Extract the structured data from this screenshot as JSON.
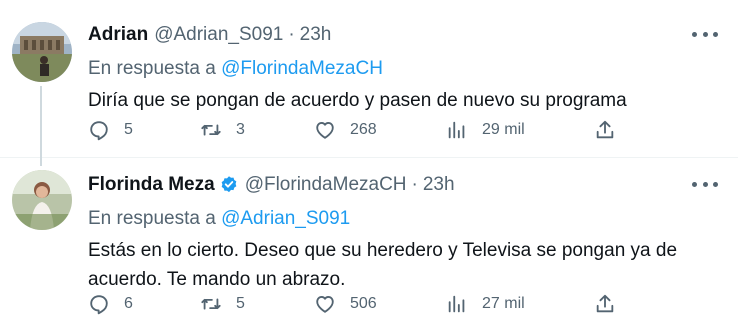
{
  "colors": {
    "link": "#1d9bf0",
    "secondary_text": "#536471",
    "primary_text": "#0f1419",
    "verified": "#1d9bf0"
  },
  "tweets": [
    {
      "name": "Adrian",
      "verified": false,
      "handle": "@Adrian_S091",
      "dot": "·",
      "time": "23h",
      "reply_prefix": "En respuesta a",
      "reply_to": "@FlorindaMezaCH",
      "text": "Diría que se pongan de acuerdo y pasen de nuevo su programa",
      "replies": "5",
      "retweets": "3",
      "likes": "268",
      "views": "29 mil"
    },
    {
      "name": "Florinda Meza",
      "verified": true,
      "handle": "@FlorindaMezaCH",
      "dot": "·",
      "time": "23h",
      "reply_prefix": "En respuesta a",
      "reply_to": "@Adrian_S091",
      "text": "Estás en lo cierto. Deseo que su heredero y Televisa se pongan ya de acuerdo. Te mando un abrazo.",
      "replies": "6",
      "retweets": "5",
      "likes": "506",
      "views": "27 mil"
    }
  ]
}
